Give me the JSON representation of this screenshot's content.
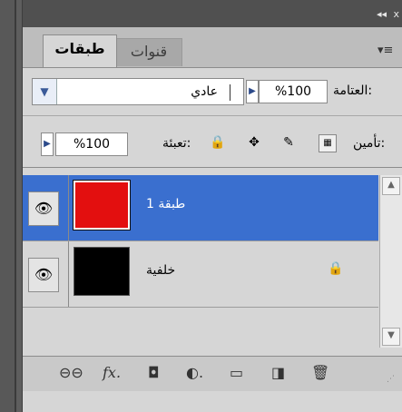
{
  "titlebar": {
    "collapse_icon": "double-chevron-icon",
    "close_icon": "close-icon",
    "collapse_text": "◂◂",
    "close_text": "x"
  },
  "tabs": [
    {
      "label": "طبقات",
      "active": true
    },
    {
      "label": "قنوات",
      "active": false
    }
  ],
  "panel_menu_icon": "menu-icon",
  "blend_mode": {
    "value": "عادي"
  },
  "opacity": {
    "label": "العتامة:",
    "value": "%100"
  },
  "lock": {
    "label": "تأمين:"
  },
  "fill": {
    "label": "تعبئة:",
    "value": "%100"
  },
  "layers": [
    {
      "name": "طبقة 1",
      "selected": true,
      "thumb_color": "#e30f0f"
    },
    {
      "name": "خلفية",
      "selected": false,
      "thumb_color": "#000000",
      "locked": true
    }
  ],
  "bottom_icons": [
    "link-icon",
    "fx-icon",
    "mask-icon",
    "adjustment-icon",
    "folder-icon",
    "new-layer-icon",
    "trash-icon"
  ]
}
